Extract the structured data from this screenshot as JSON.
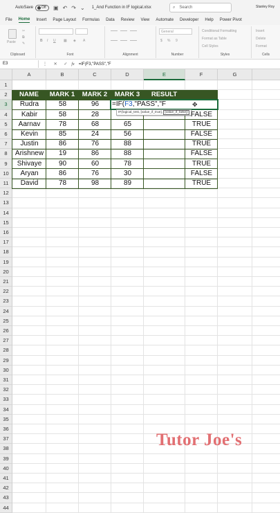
{
  "titlebar": {
    "autosave_label": "AutoSave",
    "autosave_state": "Off",
    "file_name": "1_And Function in IF logical.xlsx",
    "search_placeholder": "Search",
    "user_name": "Stanley Roy"
  },
  "menu": [
    "File",
    "Home",
    "Insert",
    "Page Layout",
    "Formulas",
    "Data",
    "Review",
    "View",
    "Automate",
    "Developer",
    "Help",
    "Power Pivot"
  ],
  "menu_active": "Home",
  "ribbon": {
    "groups": [
      "Clipboard",
      "Font",
      "Alignment",
      "Number",
      "Styles",
      "Cells"
    ],
    "paste_label": "Paste",
    "number_format": "General",
    "styles_items": [
      "Conditional Formatting",
      "Format as Table",
      "Cell Styles"
    ],
    "cells_items": [
      "Insert",
      "Delete",
      "Format"
    ]
  },
  "formula_bar": {
    "name_box": "E3",
    "fx": "fx",
    "formula": "=IF(F3,\"PASS\",\"F"
  },
  "columns": [
    "A",
    "B",
    "C",
    "D",
    "E",
    "F",
    "G"
  ],
  "selected_column": "E",
  "rows": [
    "1",
    "2",
    "3",
    "4",
    "5",
    "6",
    "7",
    "8",
    "9",
    "10",
    "11",
    "12",
    "13",
    "14",
    "15",
    "16",
    "17",
    "18",
    "19",
    "20",
    "21",
    "22",
    "23",
    "24",
    "25",
    "26",
    "27",
    "28",
    "29",
    "30",
    "31",
    "32",
    "33",
    "34",
    "35",
    "36",
    "37",
    "38",
    "39",
    "40",
    "41",
    "42",
    "43",
    "44"
  ],
  "selected_row": "3",
  "table": {
    "headers": [
      "NAME",
      "MARK 1",
      "MARK 2",
      "MARK 3",
      "RESULT"
    ],
    "rows": [
      {
        "name": "Rudra",
        "m1": "58",
        "m2": "96",
        "m3": "",
        "result": "",
        "f": ""
      },
      {
        "name": "Kabir",
        "m1": "58",
        "m2": "28",
        "m3": "",
        "result": "",
        "f": "FALSE"
      },
      {
        "name": "Aarnav",
        "m1": "78",
        "m2": "68",
        "m3": "65",
        "result": "",
        "f": "TRUE"
      },
      {
        "name": "Kevin",
        "m1": "85",
        "m2": "24",
        "m3": "56",
        "result": "",
        "f": "FALSE"
      },
      {
        "name": "Justin",
        "m1": "86",
        "m2": "76",
        "m3": "88",
        "result": "",
        "f": "TRUE"
      },
      {
        "name": "Arishnew",
        "m1": "19",
        "m2": "86",
        "m3": "88",
        "result": "",
        "f": "FALSE"
      },
      {
        "name": "Shivaye",
        "m1": "90",
        "m2": "60",
        "m3": "78",
        "result": "",
        "f": "TRUE"
      },
      {
        "name": "Aryan",
        "m1": "86",
        "m2": "76",
        "m3": "30",
        "result": "",
        "f": "FALSE"
      },
      {
        "name": "David",
        "m1": "78",
        "m2": "98",
        "m3": "89",
        "result": "",
        "f": "TRUE"
      }
    ]
  },
  "edit": {
    "prefix": "=IF(",
    "ref": "F3",
    "suffix": ",\"PASS\",\"F",
    "tooltip_fn": "IF(logical_test, [value_if_true],",
    "tooltip_current": "[value_if_false])"
  },
  "watermark": "Tutor Joe's",
  "colors": {
    "accent": "#1a6b3a",
    "header_fill": "#375623",
    "watermark": "#e26f72"
  }
}
